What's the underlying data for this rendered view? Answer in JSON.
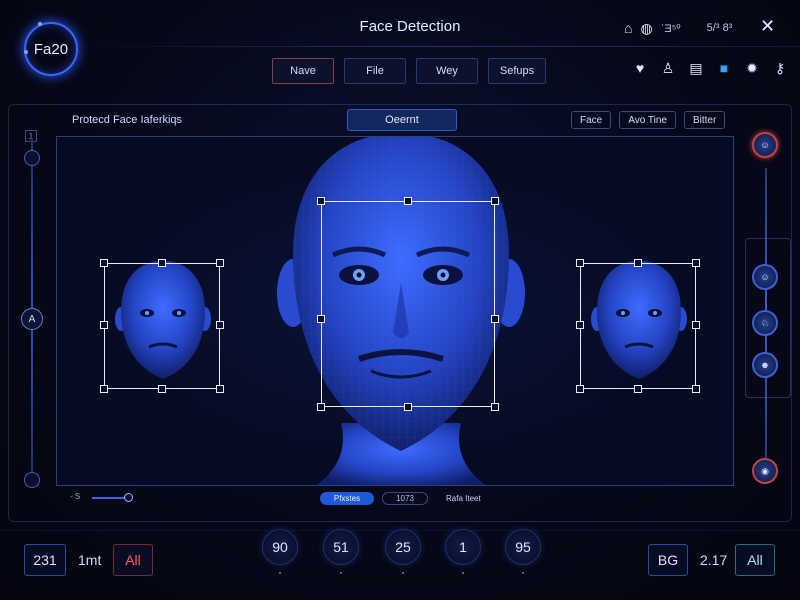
{
  "app": {
    "logo_text": "Fa20",
    "title": "Face Detection"
  },
  "system": {
    "home_icon": "home-icon",
    "status_text_1": "ʿƎ⁵⁰",
    "status_text_2": "5/³ 8³",
    "close_icon": "close-icon"
  },
  "menu": {
    "items": [
      {
        "label": "Nave"
      },
      {
        "label": "File"
      },
      {
        "label": "Wey"
      },
      {
        "label": "Sefups"
      }
    ]
  },
  "toolbar": {
    "icons": [
      "heart-icon",
      "person-icon",
      "document-icon",
      "folder-icon",
      "gear-icon",
      "key-icon"
    ]
  },
  "panel": {
    "label": "Protecd Face Iaferkiqs",
    "current_button": "Oeernt",
    "filters": [
      {
        "label": "Face"
      },
      {
        "label": "Avo Tine"
      },
      {
        "label": "Bitter"
      }
    ]
  },
  "left_slider": {
    "top_marker": "1",
    "center_glyph": "A"
  },
  "right_rail": {
    "avatars": [
      "face-avatar-1",
      "face-avatar-2",
      "face-avatar-3",
      "face-avatar-4",
      "face-avatar-5"
    ]
  },
  "scrubber": {
    "label": "- S",
    "segments": [
      {
        "label": "Pfxstes"
      },
      {
        "label": "1073"
      },
      {
        "label": "Rafa Iteet"
      }
    ]
  },
  "bottom": {
    "left_value": "231",
    "unit_text": "1mt",
    "all_left": "All",
    "counters": [
      "90",
      "51",
      "25",
      "1",
      "95"
    ],
    "bg_label": "BG",
    "right_value": "2.17",
    "all_right": "All"
  },
  "colors": {
    "accent": "#3a66ff",
    "face_blue": "#2a4fd8",
    "alert_red": "#ff5a66",
    "teal": "#9fe8ff"
  }
}
